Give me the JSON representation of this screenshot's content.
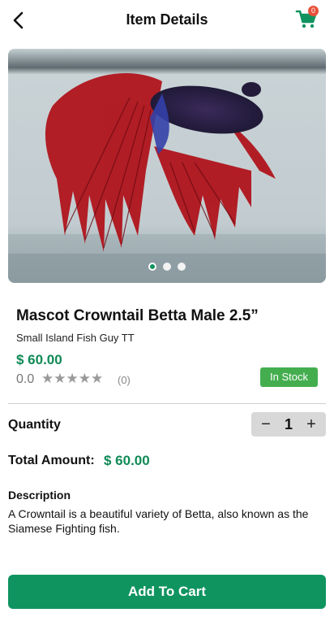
{
  "header": {
    "title": "Item Details",
    "back_icon": "chevron-left-icon",
    "cart_icon": "shopping-cart-icon",
    "cart_count": "0"
  },
  "gallery": {
    "image_description_icon": "betta-fish-photo",
    "total_images": 3,
    "active_index": 0
  },
  "product": {
    "name": "Mascot Crowntail Betta Male 2.5”",
    "seller": "Small Island Fish Guy TT",
    "price": "$ 60.00",
    "rating": "0.0",
    "stars": "★★★★★",
    "star_count_filled": 0,
    "review_count": "(0)",
    "stock_status": "In Stock"
  },
  "quantity": {
    "label": "Quantity",
    "decrement": "−",
    "value": "1",
    "increment": "+"
  },
  "total": {
    "label": "Total Amount:",
    "value": "$ 60.00"
  },
  "description": {
    "heading": "Description",
    "text": "A Crowntail is a beautiful variety of Betta, also known as the Siamese Fighting fish."
  },
  "actions": {
    "add_to_cart": "Add To Cart"
  },
  "colors": {
    "accent": "#0f9460",
    "price": "#0f8a55",
    "badge": "#e8503a",
    "stock": "#44ae4f"
  }
}
